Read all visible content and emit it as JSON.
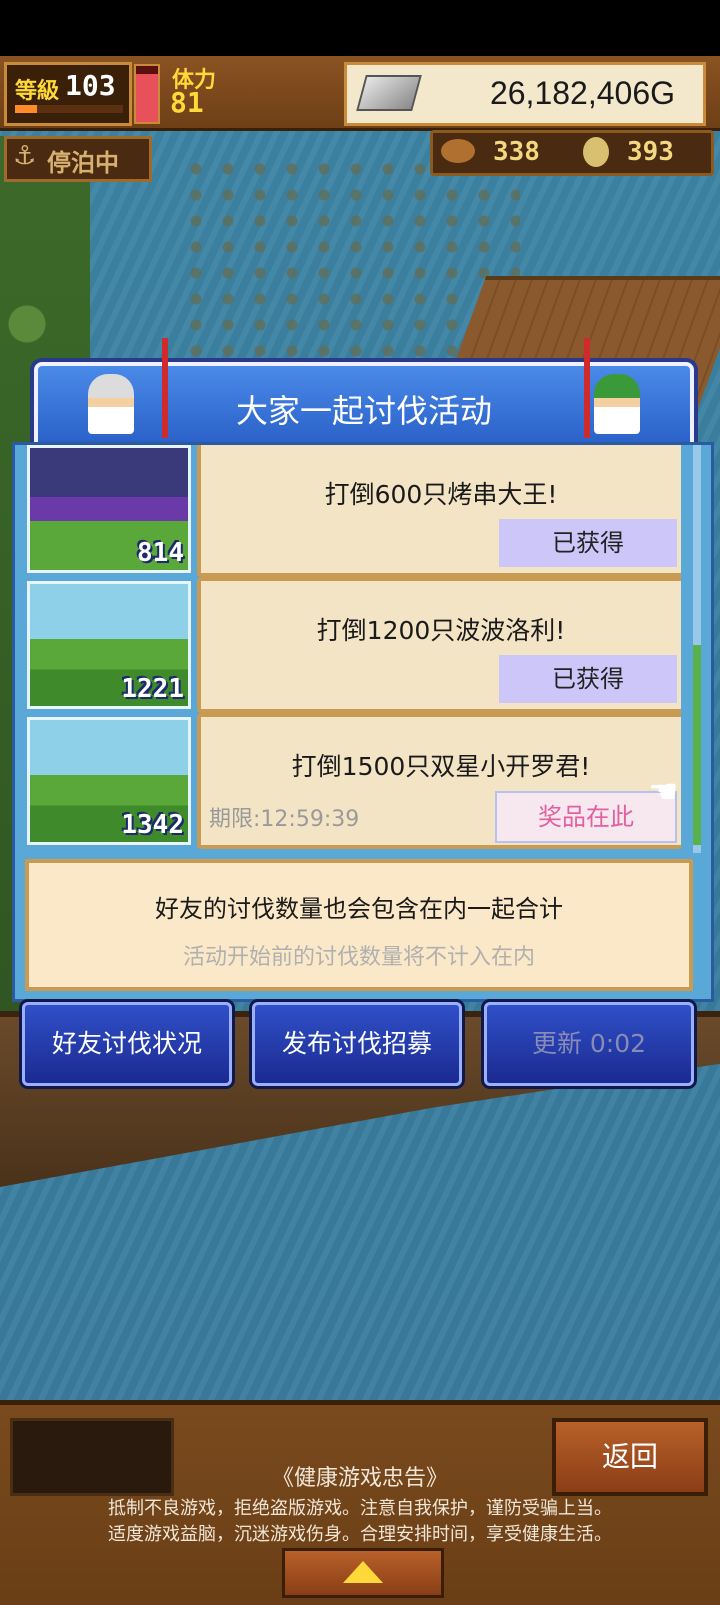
{
  "hud": {
    "level_label": "等級",
    "level": "103",
    "level_progress": 0.2,
    "stamina_label": "体力",
    "stamina": "81",
    "stamina_fill": 0.85,
    "gold": "26,182,406G",
    "dock_status": "停泊中",
    "resource_a": "338",
    "resource_b": "393"
  },
  "event": {
    "title": "大家一起讨伐活动",
    "missions": [
      {
        "count": "814",
        "text": "打倒600只烤串大王!",
        "status": "已获得",
        "deadline": ""
      },
      {
        "count": "1221",
        "text": "打倒1200只波波洛利!",
        "status": "已获得",
        "deadline": ""
      },
      {
        "count": "1342",
        "text": "打倒1500只双星小开罗君!",
        "status": "奖品在此",
        "deadline": "期限:12:59:39"
      }
    ],
    "note_main": "好友的讨伐数量也会包含在内一起合计",
    "note_sub": "活动开始前的讨伐数量将不计入在内"
  },
  "actions": {
    "friend_status": "好友讨伐状况",
    "post_recruit": "发布讨伐招募",
    "refresh": "更新 0:02"
  },
  "bottom": {
    "back": "返回",
    "health_title": "《健康游戏忠告》",
    "health_line1": "抵制不良游戏，拒绝盗版游戏。注意自我保护，谨防受骗上当。",
    "health_line2": "适度游戏益脑，沉迷游戏伤身。合理安排时间，享受健康生活。"
  },
  "colors": {
    "accent_blue": "#2a60c8",
    "parchment": "#f3e4c6",
    "prize_pink": "#e060a0",
    "claimed_lilac": "#cdc6f8"
  }
}
